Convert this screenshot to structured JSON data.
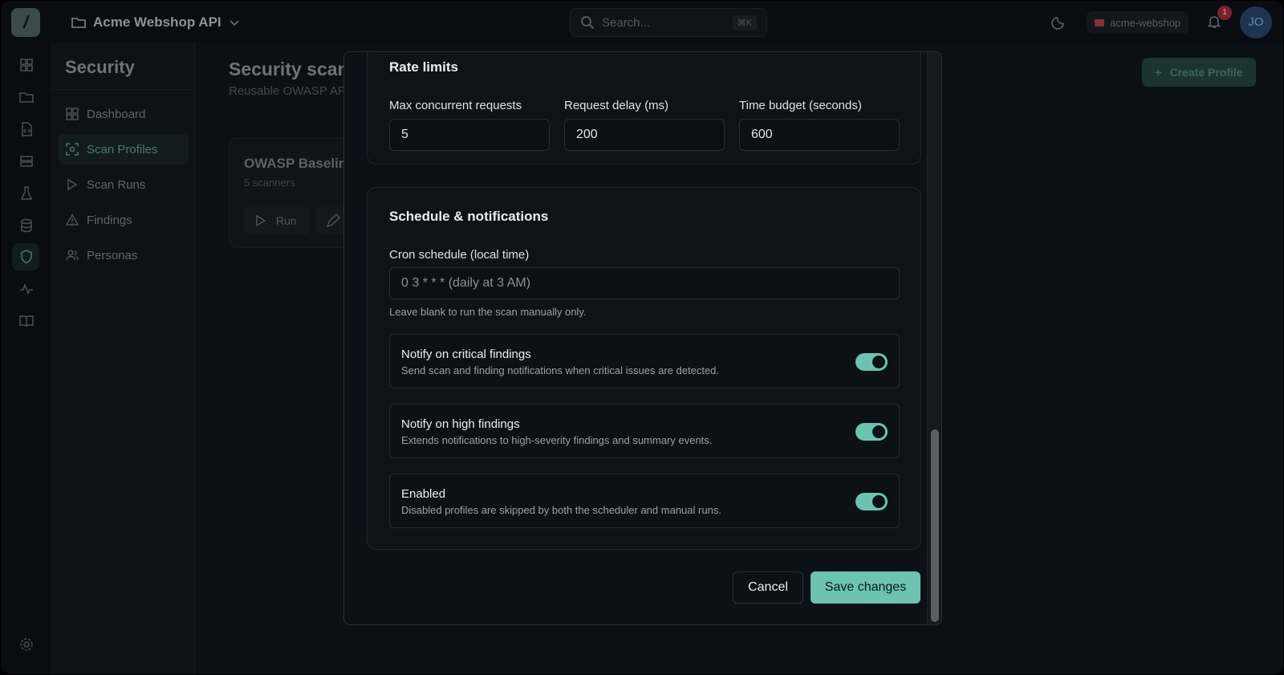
{
  "app": {
    "project_name": "Acme Webshop API",
    "search_placeholder": "Search...",
    "search_shortcut": "⌘K",
    "workspace": "acme-webshop",
    "notification_count": "1",
    "user_initials": "JO"
  },
  "sidebar": {
    "title": "Security",
    "items": [
      {
        "label": "Dashboard",
        "icon": "grid-icon"
      },
      {
        "label": "Scan Profiles",
        "icon": "scan-icon",
        "active": true
      },
      {
        "label": "Scan Runs",
        "icon": "play-icon"
      },
      {
        "label": "Findings",
        "icon": "warning-icon"
      },
      {
        "label": "Personas",
        "icon": "users-icon"
      }
    ]
  },
  "main": {
    "title": "Security scan",
    "subtitle": "Reusable OWASP AP",
    "create_button": "Create Profile",
    "profile_card": {
      "title": "OWASP Baselin",
      "subtitle": "5 scanners",
      "run_label": "Run"
    }
  },
  "modal": {
    "rate_limits": {
      "title": "Rate limits",
      "fields": [
        {
          "label": "Max concurrent requests",
          "value": "5"
        },
        {
          "label": "Request delay (ms)",
          "value": "200"
        },
        {
          "label": "Time budget (seconds)",
          "value": "600"
        }
      ]
    },
    "schedule": {
      "title": "Schedule & notifications",
      "cron_label": "Cron schedule (local time)",
      "cron_placeholder": "0 3 * * *  (daily at 3 AM)",
      "cron_help": "Leave blank to run the scan manually only.",
      "toggles": [
        {
          "title": "Notify on critical findings",
          "description": "Send scan and finding notifications when critical issues are detected.",
          "on": true
        },
        {
          "title": "Notify on high findings",
          "description": "Extends notifications to high-severity findings and summary events.",
          "on": true
        },
        {
          "title": "Enabled",
          "description": "Disabled profiles are skipped by both the scheduler and manual runs.",
          "on": true
        }
      ]
    },
    "cancel_label": "Cancel",
    "save_label": "Save changes"
  },
  "colors": {
    "accent": "#6cc3b2",
    "surface": "#0c1117",
    "backdrop": "#0b1016"
  }
}
